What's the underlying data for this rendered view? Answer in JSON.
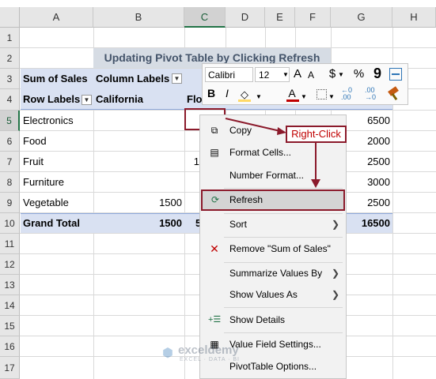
{
  "columns": [
    "A",
    "B",
    "C",
    "D",
    "E",
    "F",
    "G",
    "H"
  ],
  "rows": [
    "1",
    "2",
    "3",
    "4",
    "5",
    "6",
    "7",
    "8",
    "9",
    "10",
    "11",
    "12",
    "13",
    "14",
    "15",
    "16",
    "17"
  ],
  "title": "Updating Pivot Table by Clicking Refresh",
  "pivot": {
    "sum_of_sales": "Sum of Sales",
    "column_labels": "Column Labels",
    "row_labels": "Row Labels",
    "california": "California",
    "florida_partial": "Flo",
    "rows": [
      {
        "label": "Electronics",
        "b": "",
        "c": "",
        "g": "6500"
      },
      {
        "label": "Food",
        "b": "",
        "c": "",
        "g": "2000"
      },
      {
        "label": "Fruit",
        "b": "",
        "c": "1",
        "g": "2500"
      },
      {
        "label": "Furniture",
        "b": "",
        "c": "",
        "g": "3000"
      },
      {
        "label": "Vegetable",
        "b": "1500",
        "c": "",
        "g": "2500"
      }
    ],
    "grand_total": {
      "label": "Grand Total",
      "b": "1500",
      "c": "5",
      "g": "16500"
    }
  },
  "toolbar": {
    "font": "Calibri",
    "size": "12",
    "grow": "A",
    "shrink": "A",
    "currency": "$",
    "percent": "%",
    "comma": "9",
    "bold": "B",
    "italic": "I",
    "font_color": "A",
    "inc_decimal": "←0 .00",
    "dec_decimal": ".00 →0"
  },
  "callout": "Right-Click",
  "menu": {
    "items": [
      {
        "label": "Copy",
        "icon": "copy-icon"
      },
      {
        "label": "Format Cells...",
        "icon": "format-cells-icon"
      },
      {
        "label": "Number Format...",
        "icon": ""
      },
      {
        "label": "Refresh",
        "icon": "refresh-icon"
      },
      {
        "label": "Sort",
        "icon": ""
      },
      {
        "label": "Remove \"Sum of Sales\"",
        "icon": "remove-icon"
      },
      {
        "label": "Summarize Values By",
        "icon": ""
      },
      {
        "label": "Show Values As",
        "icon": ""
      },
      {
        "label": "Show Details",
        "icon": "show-details-icon"
      },
      {
        "label": "Value Field Settings...",
        "icon": "field-settings-icon"
      },
      {
        "label": "PivotTable Options...",
        "icon": ""
      }
    ]
  },
  "watermark": {
    "name": "exceldemy",
    "tagline": "EXCEL · DATA · BI"
  },
  "colors": {
    "accent": "#217346",
    "callout": "#8b1a2b",
    "refresh_highlight": "#d4d4d4",
    "pivot_band": "#d9e1f2"
  }
}
